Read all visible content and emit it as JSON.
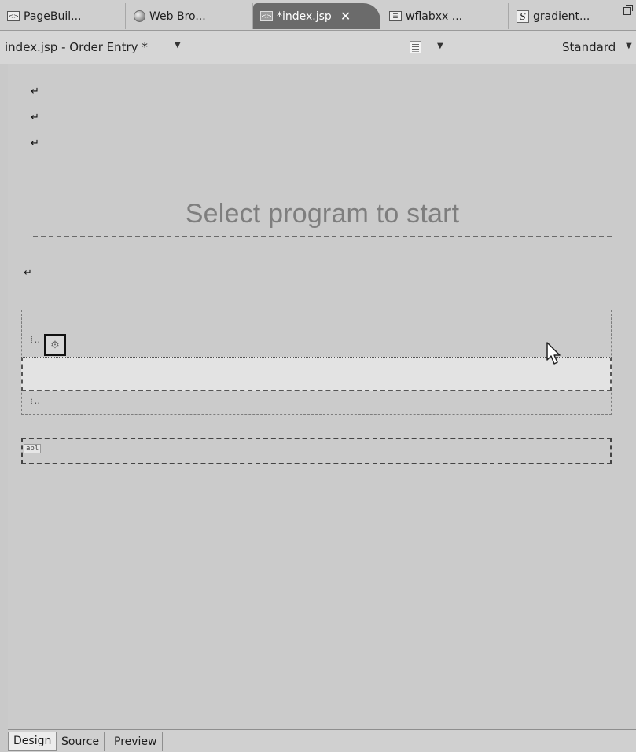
{
  "tabs": [
    {
      "label": "PageBuil...",
      "icon": "jsp-file-icon"
    },
    {
      "label": "Web Bro...",
      "icon": "globe-icon"
    },
    {
      "label": "*index.jsp",
      "icon": "jsp-file-icon",
      "active": true
    },
    {
      "label": "wflabxx ...",
      "icon": "table-icon"
    },
    {
      "label": "gradient...",
      "icon": "style-icon"
    }
  ],
  "header": {
    "title": "index.jsp - Order Entry *",
    "layout_selector": "Standard"
  },
  "canvas": {
    "paragraph_mark": "↵",
    "heading": "Select program to start",
    "text_field_tag": "abl"
  },
  "bottom_tabs": [
    "Design",
    "Source",
    "Preview"
  ],
  "colors": {
    "active_tab": "#6b6b6b",
    "canvas_background": "#cbcbcb",
    "heading_text": "#7e7e7e"
  }
}
